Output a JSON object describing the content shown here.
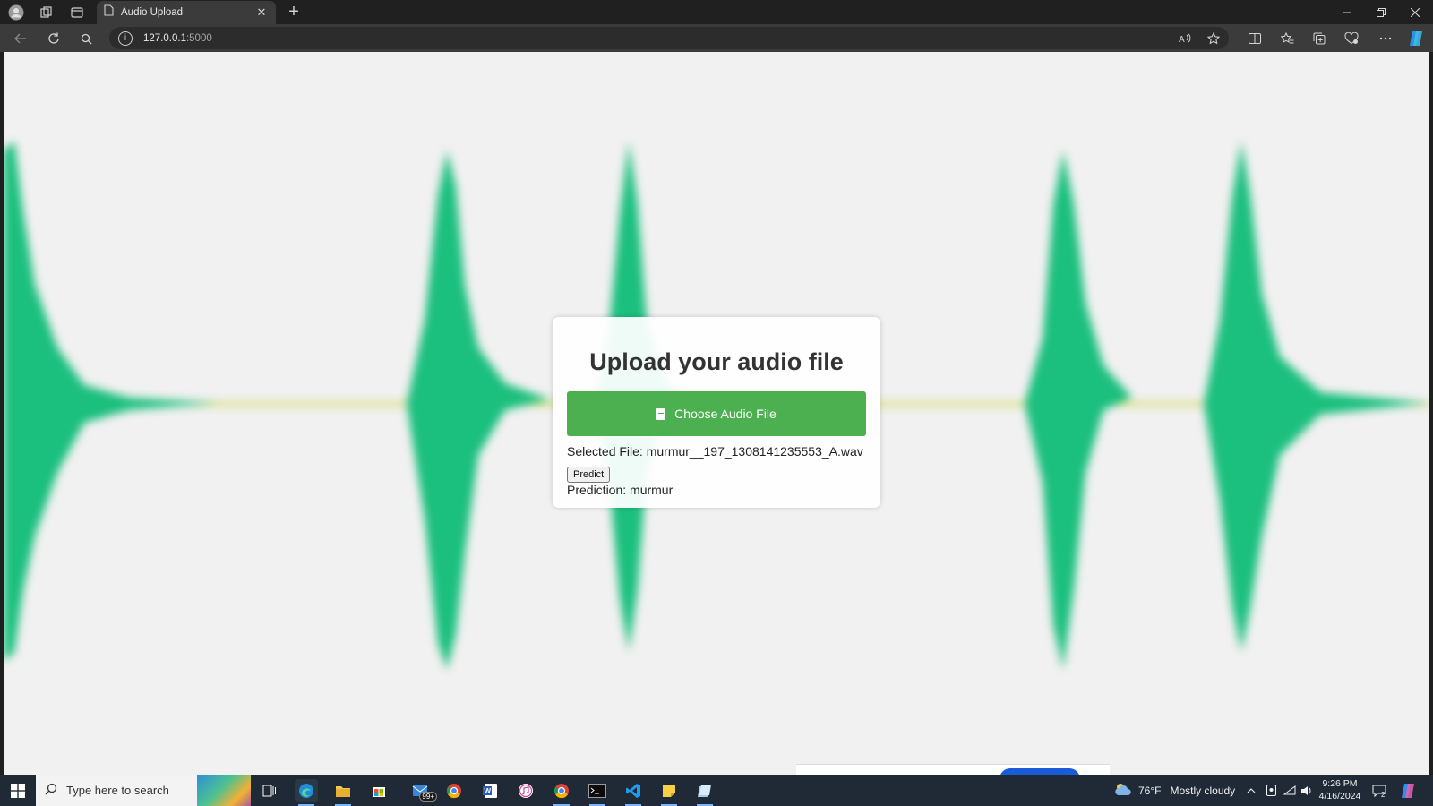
{
  "browser": {
    "tab_title": "Audio Upload",
    "url_host": "127.0.0.1",
    "url_port": ":5000",
    "new_tab_glyph": "+",
    "close_tab_glyph": "✕"
  },
  "page": {
    "heading": "Upload your audio file",
    "choose_button_label": "Choose Audio File",
    "selected_file_text": "Selected File: murmur__197_1308141235553_A.wav",
    "predict_button_label": "Predict",
    "prediction_text": "Prediction: murmur",
    "background": "heart-sound waveform (blurred)",
    "accent_color": "#4caf50",
    "waveform_color": "#1bbf7e"
  },
  "taskbar": {
    "search_placeholder": "Type here to search",
    "mail_badge": "99+",
    "weather_temp": "76°F",
    "weather_text": "Mostly cloudy",
    "time": "9:26 PM",
    "date": "4/16/2024",
    "notification_count": "2"
  },
  "icons": {
    "profile": "profile-icon",
    "workspaces": "workspaces-icon",
    "tab_actions": "tab-actions-icon",
    "back": "back-arrow-icon",
    "refresh": "refresh-icon",
    "search": "search-icon",
    "info": "info-icon",
    "read_aloud": "read-aloud-icon",
    "favorite": "star-icon",
    "split": "split-screen-icon",
    "favorites": "favorites-icon",
    "collections": "collections-icon",
    "extensions": "extensions-icon",
    "more": "more-icon",
    "copilot": "copilot-icon"
  }
}
